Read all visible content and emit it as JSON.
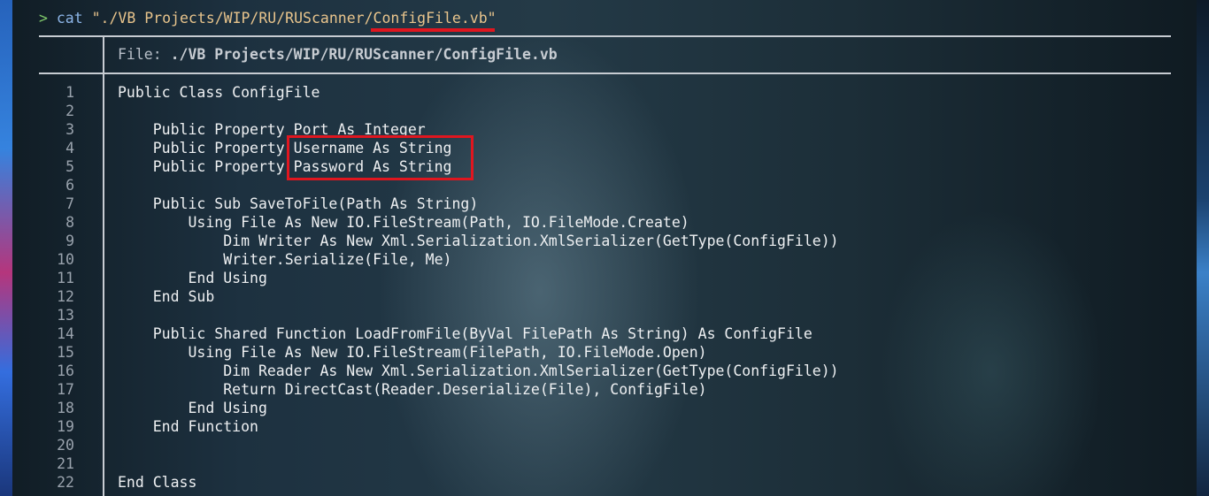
{
  "terminal": {
    "prompt_symbol": ">",
    "command": "cat",
    "arg_prefix": "\"./VB Projects/WIP/RU/RUScanner/",
    "arg_filename": "ConfigFile.vb",
    "arg_suffix": "\""
  },
  "viewer": {
    "file_label": "File:",
    "file_path": "./VB Projects/WIP/RU/RUScanner/ConfigFile.vb"
  },
  "code_lines": [
    {
      "num": "1",
      "text": "Public Class ConfigFile"
    },
    {
      "num": "2",
      "text": ""
    },
    {
      "num": "3",
      "text": "    Public Property Port As Integer"
    },
    {
      "num": "4",
      "text": "    Public Property Username As String"
    },
    {
      "num": "5",
      "text": "    Public Property Password As String"
    },
    {
      "num": "6",
      "text": ""
    },
    {
      "num": "7",
      "text": "    Public Sub SaveToFile(Path As String)"
    },
    {
      "num": "8",
      "text": "        Using File As New IO.FileStream(Path, IO.FileMode.Create)"
    },
    {
      "num": "9",
      "text": "            Dim Writer As New Xml.Serialization.XmlSerializer(GetType(ConfigFile))"
    },
    {
      "num": "10",
      "text": "            Writer.Serialize(File, Me)"
    },
    {
      "num": "11",
      "text": "        End Using"
    },
    {
      "num": "12",
      "text": "    End Sub"
    },
    {
      "num": "13",
      "text": ""
    },
    {
      "num": "14",
      "text": "    Public Shared Function LoadFromFile(ByVal FilePath As String) As ConfigFile"
    },
    {
      "num": "15",
      "text": "        Using File As New IO.FileStream(FilePath, IO.FileMode.Open)"
    },
    {
      "num": "16",
      "text": "            Dim Reader As New Xml.Serialization.XmlSerializer(GetType(ConfigFile))"
    },
    {
      "num": "17",
      "text": "            Return DirectCast(Reader.Deserialize(File), ConfigFile)"
    },
    {
      "num": "18",
      "text": "        End Using"
    },
    {
      "num": "19",
      "text": "    End Function"
    },
    {
      "num": "20",
      "text": ""
    },
    {
      "num": "21",
      "text": ""
    },
    {
      "num": "22",
      "text": "End Class"
    }
  ],
  "colors": {
    "annotation_red": "#e0161f",
    "prompt_green": "#7ec86a",
    "command_blue": "#8cb4e6",
    "path_orange": "#e8c48c"
  }
}
